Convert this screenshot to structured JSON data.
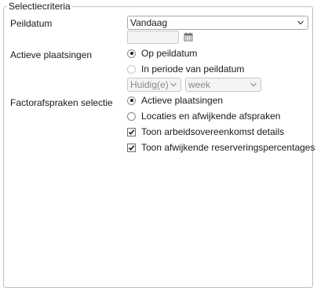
{
  "panel": {
    "title": "Selectiecriteria"
  },
  "peildatum": {
    "label": "Peildatum",
    "select_value": "Vandaag",
    "date_value": ""
  },
  "actieve_plaatsingen": {
    "label": "Actieve plaatsingen",
    "options": [
      {
        "label": "Op peildatum",
        "checked": true
      },
      {
        "label": "In periode van peildatum",
        "checked": false
      }
    ],
    "period_select": "Huidig(e)",
    "unit_select": "week"
  },
  "factorafspraken": {
    "label": "Factorafspraken selectie",
    "options": [
      {
        "label": "Actieve plaatsingen",
        "checked": true
      },
      {
        "label": "Locaties en afwijkende afspraken",
        "checked": false
      }
    ],
    "checkboxes": [
      {
        "label": "Toon arbeidsovereenkomst details",
        "checked": true
      },
      {
        "label": "Toon afwijkende reserveringspercentages",
        "checked": true
      }
    ]
  },
  "icons": {
    "calendar": "calendar-icon",
    "dropdown": "chevron-down-icon"
  }
}
